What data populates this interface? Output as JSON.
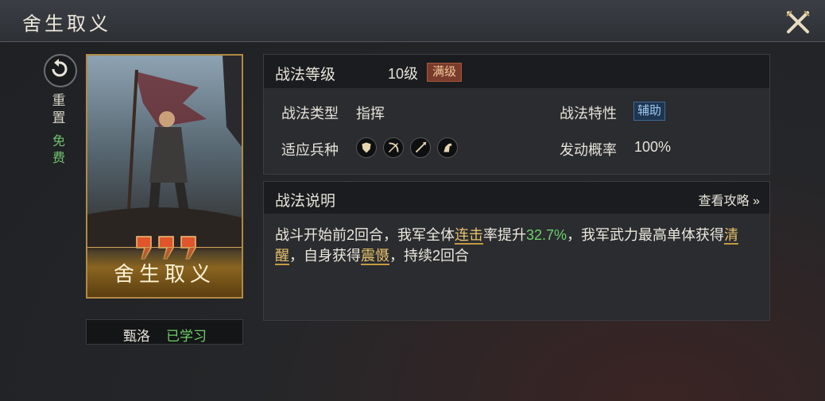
{
  "window": {
    "title": "舍生取义"
  },
  "sidebar": {
    "reset_label": "重置",
    "free_label": "免费"
  },
  "card": {
    "name": "舍生取义"
  },
  "learn": {
    "general": "甄洛",
    "status": "已学习"
  },
  "tactic": {
    "level_label": "战法等级",
    "level_value": "10级",
    "max_badge": "满级",
    "type_label": "战法类型",
    "type_value": "指挥",
    "trait_label": "战法特性",
    "trait_value": "辅助",
    "troops_label": "适应兵种",
    "troops": [
      "shield-icon",
      "bow-icon",
      "spear-icon",
      "horse-icon"
    ],
    "prob_label": "发动概率",
    "prob_value": "100%"
  },
  "description": {
    "label": "战法说明",
    "guide_link": "查看攻略 »",
    "seg1": "战斗开始前2回合，我军全体",
    "kw1": "连击",
    "seg2": "率提升",
    "num1": "32.7%",
    "seg3": "，我军武力最高单体获得",
    "kw2": "清醒",
    "seg4": "，自身获得",
    "kw3": "震慑",
    "seg5": "，持续2回合"
  },
  "colors": {
    "accent_gold": "#b08a44",
    "keyword": "#e6c06a",
    "positive": "#6fd06a",
    "max_badge": "#7a3b2c",
    "support_badge": "#1f3550"
  }
}
